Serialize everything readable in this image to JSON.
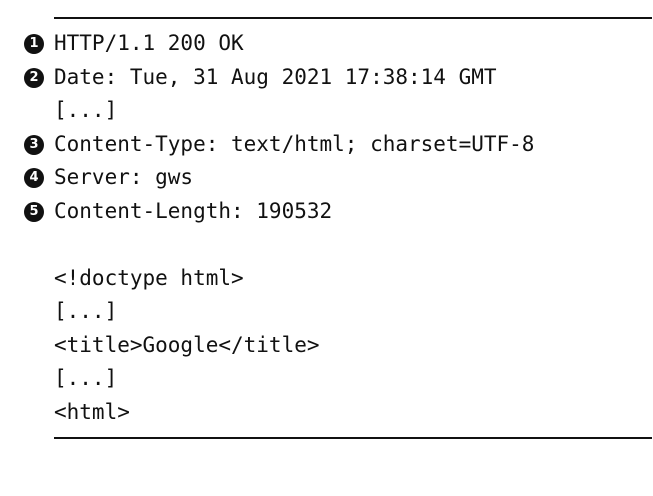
{
  "listing": {
    "lines": [
      {
        "callout": "1",
        "text": "HTTP/1.1 200 OK"
      },
      {
        "callout": "2",
        "text": "Date: Tue, 31 Aug 2021 17:38:14 GMT"
      },
      {
        "callout": "",
        "text": "[...]"
      },
      {
        "callout": "3",
        "text": "Content-Type: text/html; charset=UTF-8"
      },
      {
        "callout": "4",
        "text": "Server: gws"
      },
      {
        "callout": "5",
        "text": "Content-Length: 190532"
      },
      {
        "callout": "",
        "text": ""
      },
      {
        "callout": "",
        "text": "<!doctype html>"
      },
      {
        "callout": "",
        "text": "[...]"
      },
      {
        "callout": "",
        "text": "<title>Google</title>"
      },
      {
        "callout": "",
        "text": "[...]"
      },
      {
        "callout": "",
        "text": "<html>"
      }
    ]
  }
}
